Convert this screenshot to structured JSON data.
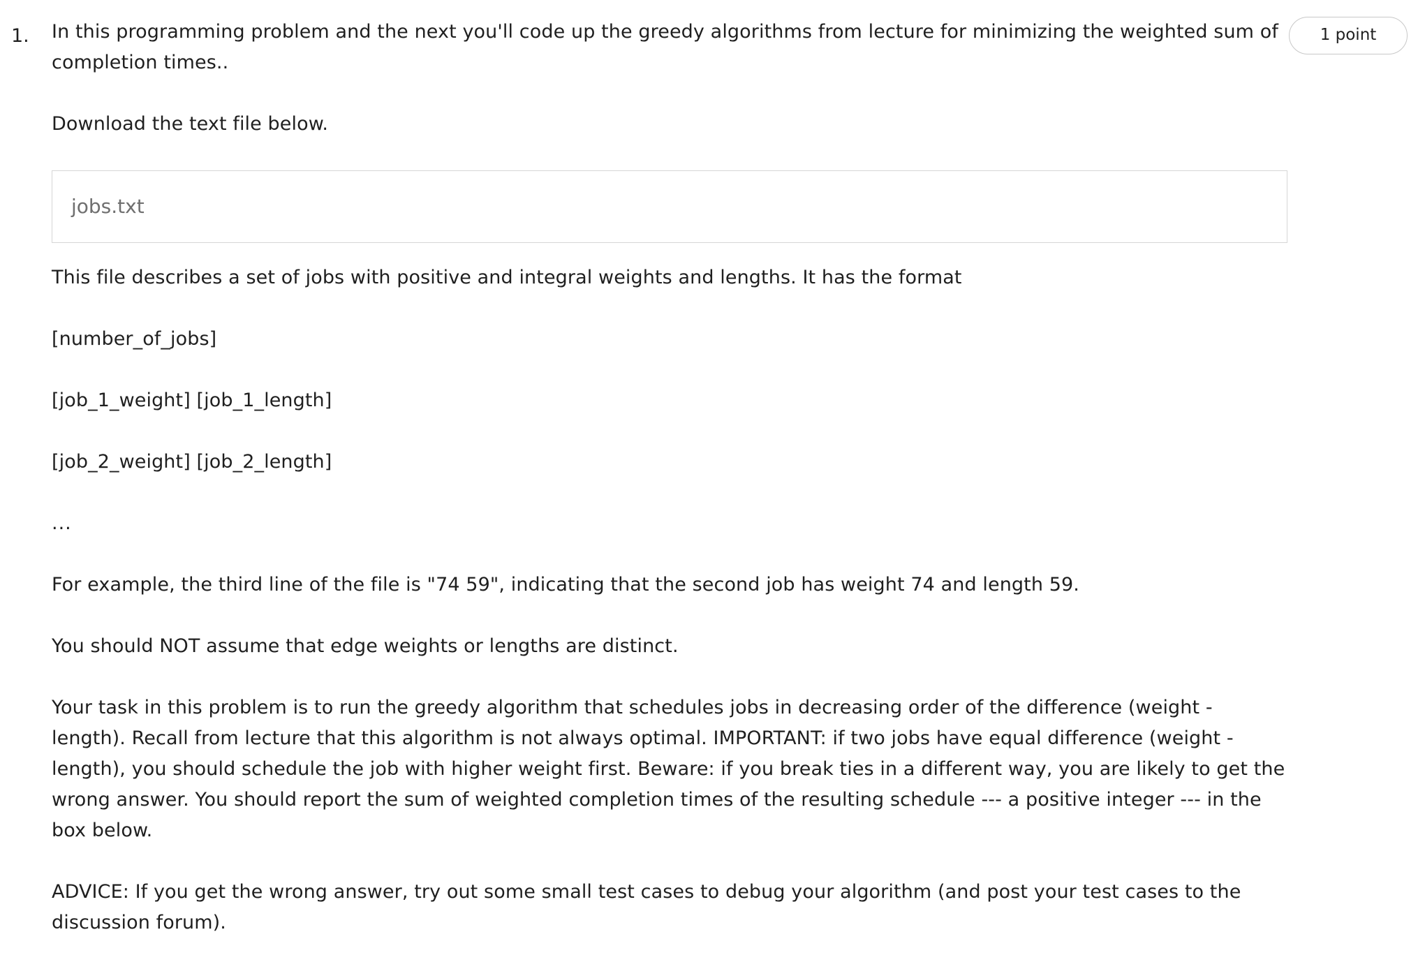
{
  "question": {
    "number": "1.",
    "points": "1 point",
    "intro": "In this programming problem and the next you'll code up the greedy algorithms from lecture for minimizing the weighted sum of completion times..",
    "download_text": "Download the text file below.",
    "file_name": "jobs.txt",
    "description": "This file describes a set of jobs with positive and integral weights and lengths. It has the format",
    "format_lines": [
      "[number_of_jobs]",
      "[job_1_weight] [job_1_length]",
      "[job_2_weight] [job_2_length]",
      "..."
    ],
    "example": "For example, the third line of the file is \"74 59\", indicating that the second job has weight 74 and length 59.",
    "distinct_note": "You should NOT assume that edge weights or lengths are distinct.",
    "task": "Your task in this problem is to run the greedy algorithm that schedules jobs in decreasing order of the difference (weight - length). Recall from lecture that this algorithm is not always optimal. IMPORTANT: if two jobs have equal difference (weight - length), you should schedule the job with higher weight first. Beware: if you break ties in a different way, you are likely to get the wrong answer. You should report the sum of weighted completion times of the resulting schedule --- a positive integer --- in the box below.",
    "advice": "ADVICE: If you get the wrong answer, try out some small test cases to debug your algorithm (and post your test cases to the discussion forum)."
  }
}
